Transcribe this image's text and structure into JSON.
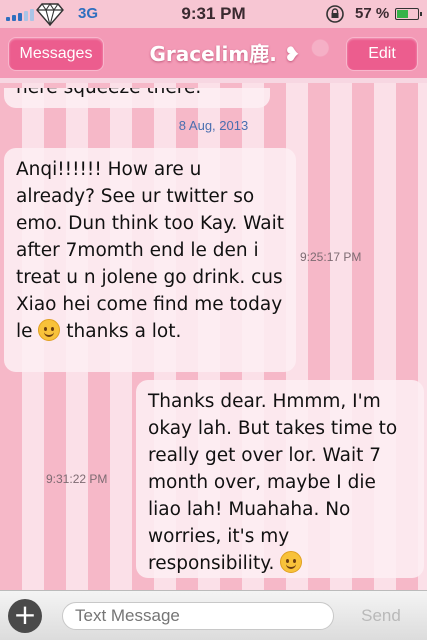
{
  "status_bar": {
    "network": "3G",
    "time": "9:31 PM",
    "battery_text": "57 %",
    "battery_level": 0.57,
    "icons": [
      "signal-bars-icon",
      "diamond-icon",
      "rotation-lock-icon",
      "battery-icon"
    ]
  },
  "nav": {
    "back_label": "Messages",
    "title": "Gracelim鹿. ❥",
    "edit_label": "Edit"
  },
  "thread": {
    "top_bubble_text": "here squeeze there.",
    "date": "8 Aug, 2013",
    "incoming": {
      "text": "Anqi!!!!!! How are u already? See ur twitter so emo. Dun think too Kay. Wait after 7momth end le den i treat u n jolene go drink. cus Xiao hei come find me today le",
      "text_after_emoji": " thanks a lot.",
      "time": "9:25:17 PM"
    },
    "outgoing": {
      "text": "Thanks dear. Hmmm, I'm okay lah. But takes time to really get over lor. Wait 7 month over, maybe I die liao lah! Muahaha. No worries, it's my responsibility. ",
      "time": "9:31:22 PM"
    }
  },
  "composer": {
    "placeholder": "Text Message",
    "send_label": "Send",
    "colors": {
      "accent": "#ec5d8e",
      "stripe_light": "#fbe0e8",
      "stripe_dark": "#f6b8c8"
    }
  }
}
